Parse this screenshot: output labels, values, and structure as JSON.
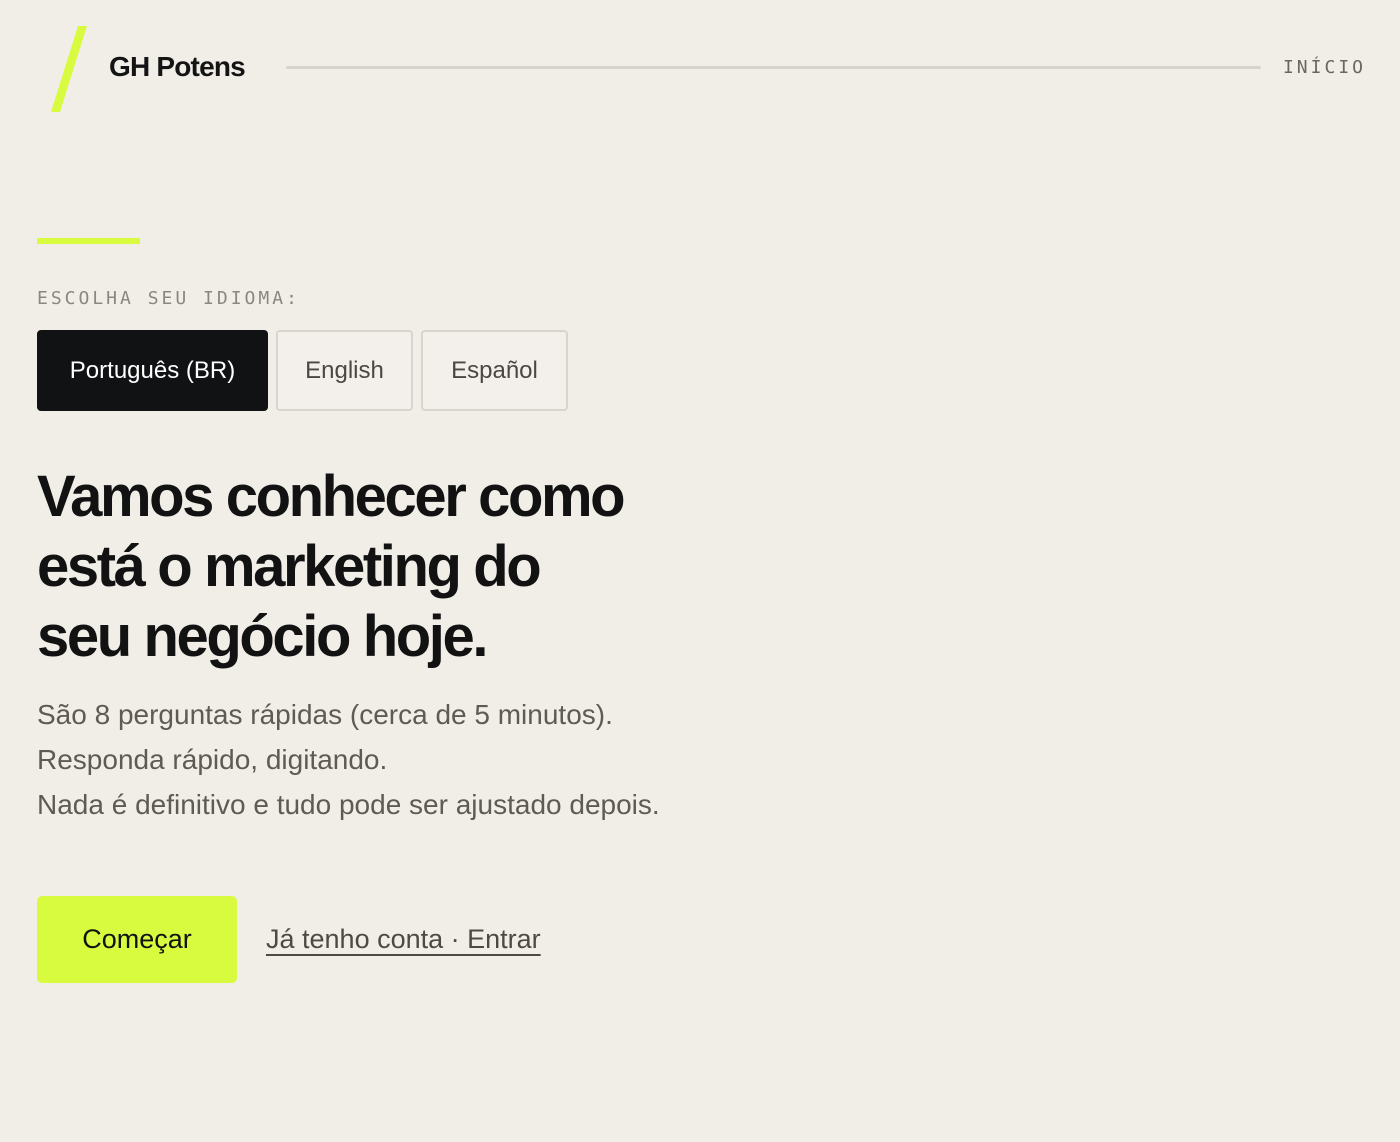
{
  "header": {
    "brand": "GH Potens",
    "nav_link": "INÍCIO"
  },
  "colors": {
    "background": "#f1eee8",
    "accent": "#d8fb3f",
    "dark": "#101213"
  },
  "language": {
    "label": "ESCOLHA SEU IDIOMA:",
    "options": [
      {
        "label": "Português (BR)",
        "selected": true
      },
      {
        "label": "English",
        "selected": false
      },
      {
        "label": "Español",
        "selected": false
      }
    ]
  },
  "hero": {
    "headline_lines": [
      "Vamos conhecer como",
      "está o marketing do",
      "seu negócio hoje."
    ],
    "sub_lines": [
      "São 8 perguntas rápidas (cerca de 5 minutos).",
      "Responda rápido, digitando.",
      "Nada é definitivo e tudo pode ser ajustado depois."
    ]
  },
  "actions": {
    "start_label": "Começar",
    "login_label": "Já tenho conta · Entrar"
  }
}
